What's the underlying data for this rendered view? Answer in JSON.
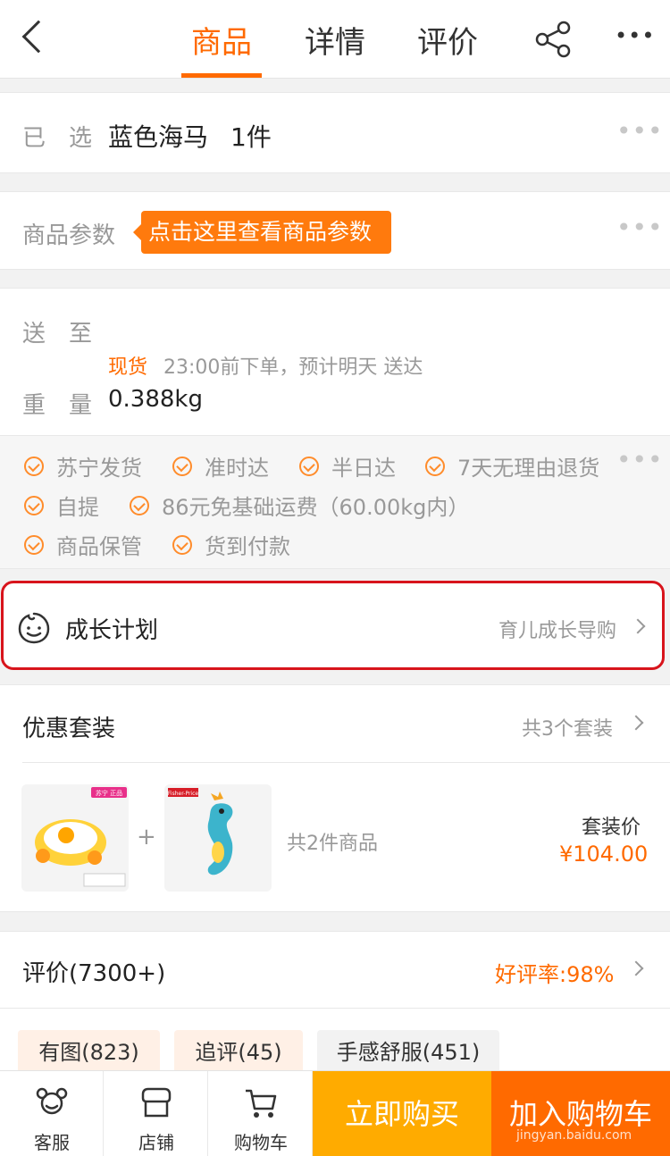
{
  "header": {
    "tabs": [
      {
        "label": "商品",
        "active": true
      },
      {
        "label": "详情",
        "active": false
      },
      {
        "label": "评价",
        "active": false
      }
    ],
    "more": "•••"
  },
  "selected": {
    "label": "已　选",
    "value": "蓝色海马",
    "qty": "1件",
    "more": "•••"
  },
  "params": {
    "label": "商品参数",
    "tooltip": "点击这里查看商品参数",
    "more": "•••"
  },
  "delivery": {
    "to_label": "送　至",
    "stock": "现货",
    "eta": "23:00前下单，预计明天 送达",
    "weight_label": "重　量",
    "weight": "0.388kg"
  },
  "services": {
    "items": [
      "苏宁发货",
      "准时达",
      "半日达",
      "7天无理由退货",
      "自提",
      "86元免基础运费（60.00kg内）",
      "商品保管",
      "货到付款"
    ],
    "more": "•••"
  },
  "growth": {
    "title": "成长计划",
    "link": "育儿成长导购"
  },
  "bundle": {
    "title": "优惠套装",
    "count": "共3个套装",
    "plus": "+",
    "items_count": "共2件商品",
    "price_label": "套装价",
    "price": "¥104.00",
    "item1_badge": "苏宁 正品",
    "item2_brand": "Fisher-Price"
  },
  "reviews": {
    "title": "评价(7300+)",
    "rate": "好评率:98%",
    "tags": [
      "有图(823)",
      "追评(45)",
      "手感舒服(451)"
    ]
  },
  "bottom": {
    "service": "客服",
    "store": "店铺",
    "cart": "购物车",
    "buy_now": "立即购买",
    "add_cart": "加入购物车",
    "watermark": "jingyan.baidu.com"
  },
  "colors": {
    "accent": "#ff6a00",
    "buy": "#ffab00",
    "highlight_border": "#d8141c"
  }
}
